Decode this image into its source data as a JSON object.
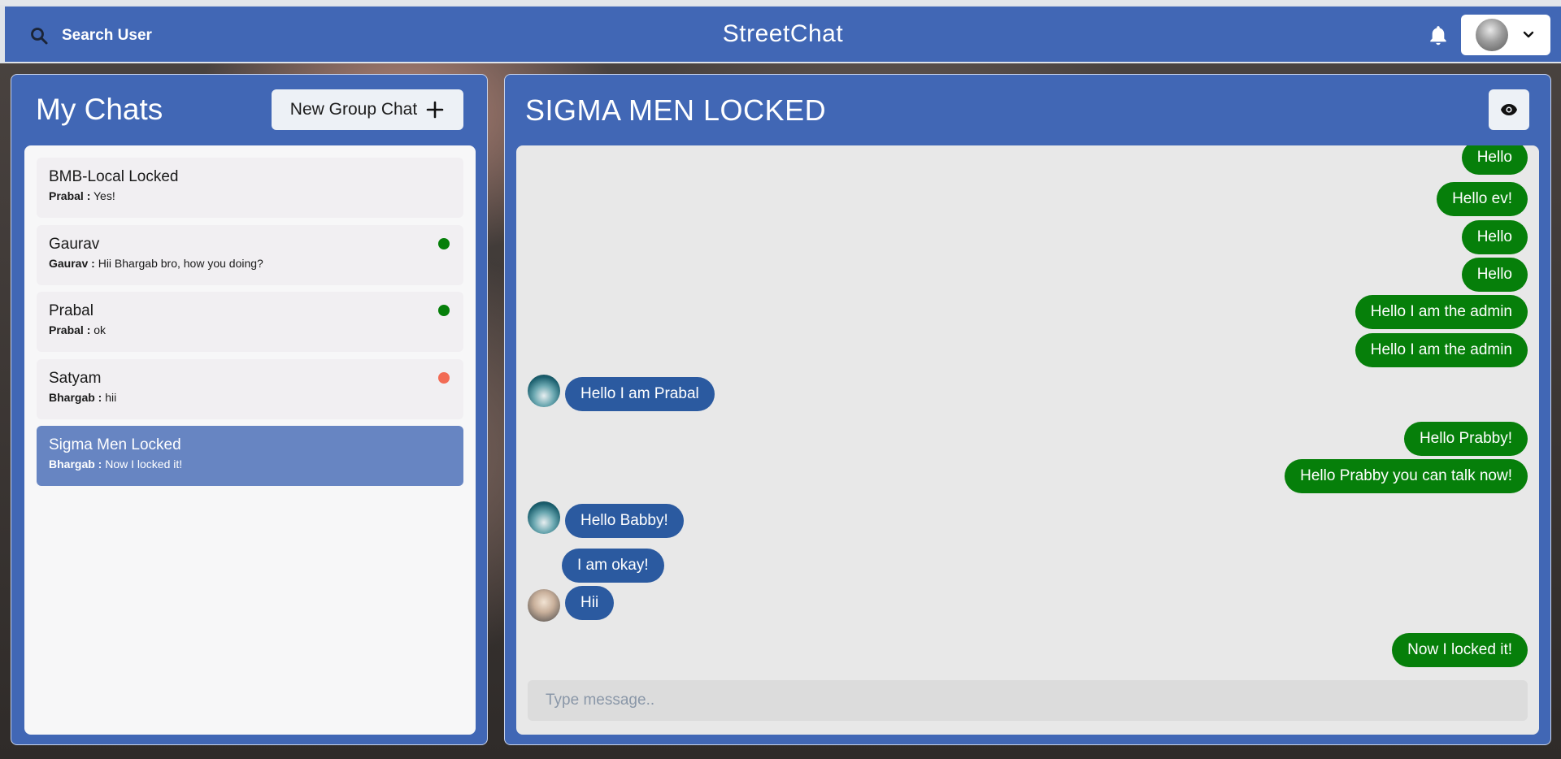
{
  "header": {
    "search_label": "Search User",
    "app_title": "StreetChat"
  },
  "sidebar": {
    "title": "My Chats",
    "new_group_label": "New Group Chat",
    "chats": [
      {
        "name": "BMB-Local Locked",
        "sender": "Prabal :",
        "message": "Yes!",
        "status": "none",
        "active": false
      },
      {
        "name": "Gaurav",
        "sender": "Gaurav :",
        "message": "Hii Bhargab bro, how you doing?",
        "status": "online",
        "active": false
      },
      {
        "name": "Prabal",
        "sender": "Prabal :",
        "message": "ok",
        "status": "online",
        "active": false
      },
      {
        "name": "Satyam",
        "sender": "Bhargab :",
        "message": "hii",
        "status": "offline",
        "active": false
      },
      {
        "name": "Sigma Men Locked",
        "sender": "Bhargab :",
        "message": "Now I locked it!",
        "status": "none",
        "active": true
      }
    ]
  },
  "chat": {
    "title": "SIGMA MEN LOCKED",
    "messages": [
      {
        "text": "Hello",
        "from": "me"
      },
      {
        "text": "Hello ev!",
        "from": "me"
      },
      {
        "text": "Hello",
        "from": "me"
      },
      {
        "text": "Hello",
        "from": "me"
      },
      {
        "text": "Hello I am the admin",
        "from": "me"
      },
      {
        "text": "Hello I am the admin",
        "from": "me"
      },
      {
        "text": "Hello I am Prabal",
        "from": "them",
        "avatar": "prabal"
      },
      {
        "text": "Hello Prabby!",
        "from": "me"
      },
      {
        "text": "Hello Prabby you can talk now!",
        "from": "me"
      },
      {
        "text": "Hello Babby!",
        "from": "them",
        "avatar": "prabal"
      },
      {
        "text": "I am okay!",
        "from": "them",
        "avatar": ""
      },
      {
        "text": "Hii",
        "from": "them",
        "avatar": "baby"
      },
      {
        "text": "Now I locked it!",
        "from": "me"
      }
    ],
    "input_placeholder": "Type message.."
  },
  "colors": {
    "primary": "#4167b5",
    "sent_bubble": "#067f0a",
    "received_bubble": "#2b5aa0",
    "online": "#067f0a",
    "offline": "#f26b55",
    "active_chat": "#6785c2"
  },
  "icons": {
    "search": "search-icon",
    "bell": "bell-icon",
    "chevron": "chevron-down-icon",
    "plus": "plus-icon",
    "eye": "eye-icon"
  }
}
